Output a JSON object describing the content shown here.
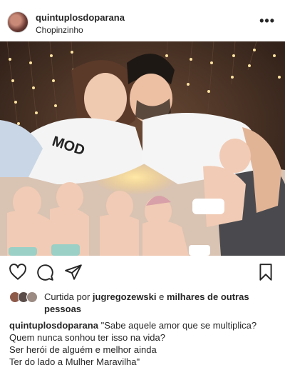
{
  "post": {
    "username": "quintuplosdoparana",
    "location": "Chopinzinho",
    "more_label": "•••"
  },
  "likes": {
    "prefix": "Curtida por ",
    "user": "jugregozewski",
    "middle": " e ",
    "suffix": "milhares de outras pessoas"
  },
  "caption": {
    "username": "quintuplosdoparana",
    "line1": "\"Sabe aquele amor que se multiplica?",
    "line2": "Quem nunca sonhou ter isso na vida?",
    "line3": "Ser herói de alguém e melhor ainda",
    "line4": "Ter do lado a Mulher Maravilha\""
  },
  "photo": {
    "shirt_text": "MOD"
  },
  "icons": {
    "heart": "heart-icon",
    "comment": "comment-icon",
    "share": "share-icon",
    "bookmark": "bookmark-icon",
    "more": "more-options-icon"
  }
}
